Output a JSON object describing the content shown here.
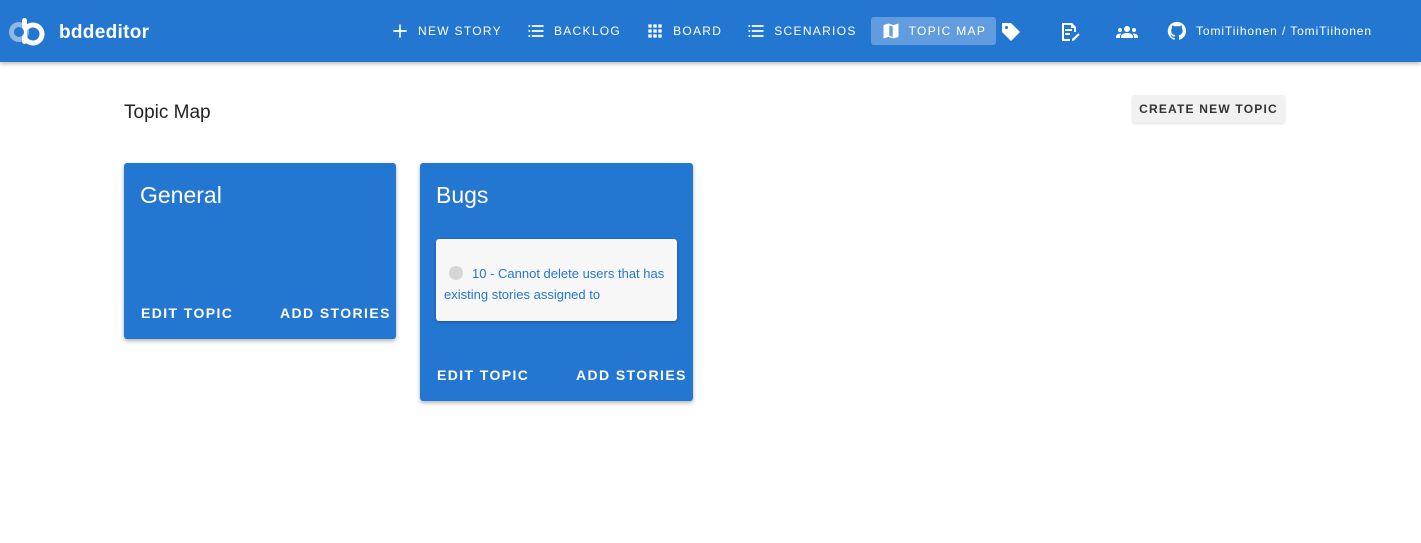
{
  "app": {
    "brand": "bddeditor"
  },
  "nav": {
    "items": [
      {
        "label": "NEW STORY",
        "icon": "plus-icon"
      },
      {
        "label": "BACKLOG",
        "icon": "list-icon"
      },
      {
        "label": "BOARD",
        "icon": "grid-icon"
      },
      {
        "label": "SCENARIOS",
        "icon": "list-icon"
      },
      {
        "label": "TOPIC MAP",
        "icon": "map-icon",
        "active": true
      }
    ],
    "icons": [
      "tag-icon",
      "edit-document-icon",
      "people-icon"
    ],
    "github": {
      "icon": "github-icon",
      "label": "TomiTiihonen / TomiTiihonen"
    }
  },
  "page": {
    "title": "Topic Map",
    "create_label": "CREATE NEW TOPIC"
  },
  "topics": [
    {
      "name": "General",
      "stories": [],
      "edit_label": "EDIT TOPIC",
      "add_label": "ADD STORIES"
    },
    {
      "name": "Bugs",
      "stories": [
        {
          "text": "10 - Cannot delete users that has existing stories assigned to"
        }
      ],
      "edit_label": "EDIT TOPIC",
      "add_label": "ADD STORIES"
    }
  ],
  "colors": {
    "primary": "#2477d1",
    "background": "#ffffff"
  }
}
